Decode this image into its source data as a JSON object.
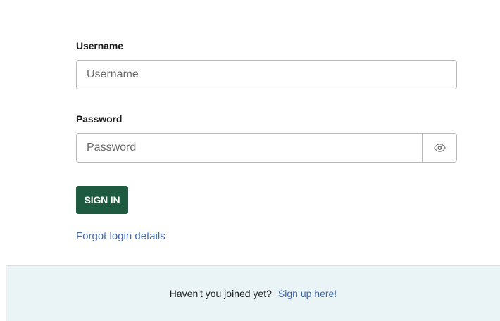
{
  "form": {
    "username": {
      "label": "Username",
      "value": "",
      "placeholder": "Username"
    },
    "password": {
      "label": "Password",
      "value": "",
      "placeholder": "Password",
      "toggle_icon": "eye-icon"
    },
    "sign_in_label": "SIGN IN",
    "forgot_link": "Forgot login details"
  },
  "footer": {
    "text": "Haven't you joined yet?",
    "signup_link": "Sign up here!"
  },
  "colors": {
    "primary_button": "#1e5a3f",
    "link": "#3f68b0",
    "footer_background": "#eaf3f5"
  }
}
